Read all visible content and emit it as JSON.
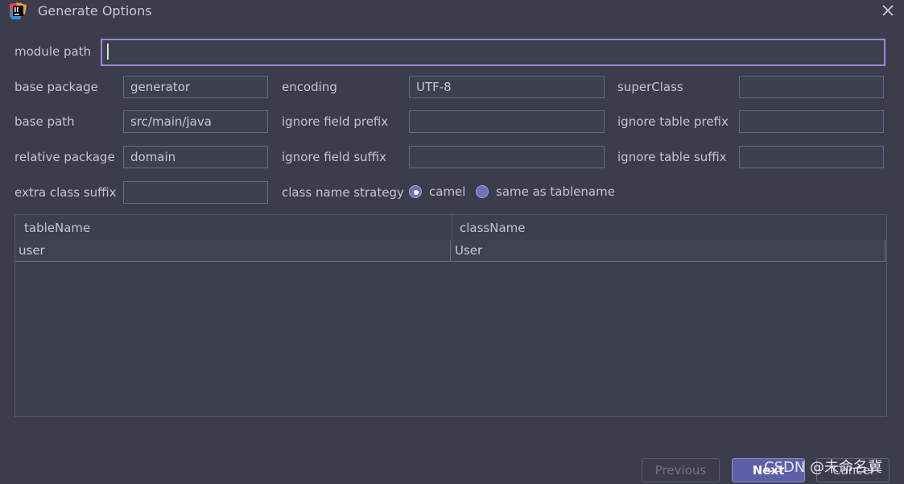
{
  "window": {
    "title": "Generate Options"
  },
  "form": {
    "module_path": {
      "label": "module path",
      "value": ""
    },
    "base_package": {
      "label": "base package",
      "value": "generator"
    },
    "encoding": {
      "label": "encoding",
      "value": "UTF-8"
    },
    "super_class": {
      "label": "superClass",
      "value": ""
    },
    "base_path": {
      "label": "base path",
      "value": "src/main/java"
    },
    "ignore_field_prefix": {
      "label": "ignore field prefix",
      "value": ""
    },
    "ignore_table_prefix": {
      "label": "ignore table prefix",
      "value": ""
    },
    "relative_package": {
      "label": "relative package",
      "value": "domain"
    },
    "ignore_field_suffix": {
      "label": "ignore field suffix",
      "value": ""
    },
    "ignore_table_suffix": {
      "label": "ignore table suffix",
      "value": ""
    },
    "extra_class_suffix": {
      "label": "extra class suffix",
      "value": ""
    },
    "class_name_strategy": {
      "label": "class name strategy",
      "options": [
        "camel",
        "same as tablename"
      ],
      "selected": "camel"
    }
  },
  "table": {
    "columns": [
      "tableName",
      "className"
    ],
    "rows": [
      {
        "tableName": "user",
        "className": "User"
      }
    ]
  },
  "buttons": {
    "previous": "Previous",
    "next": "Next",
    "cancel": "Cancel"
  },
  "watermark": "CSDN @未命名冀",
  "colors": {
    "focus_border": "#9f84dd",
    "primary_button": "#5b60a8",
    "background": "#3b3d4b"
  }
}
